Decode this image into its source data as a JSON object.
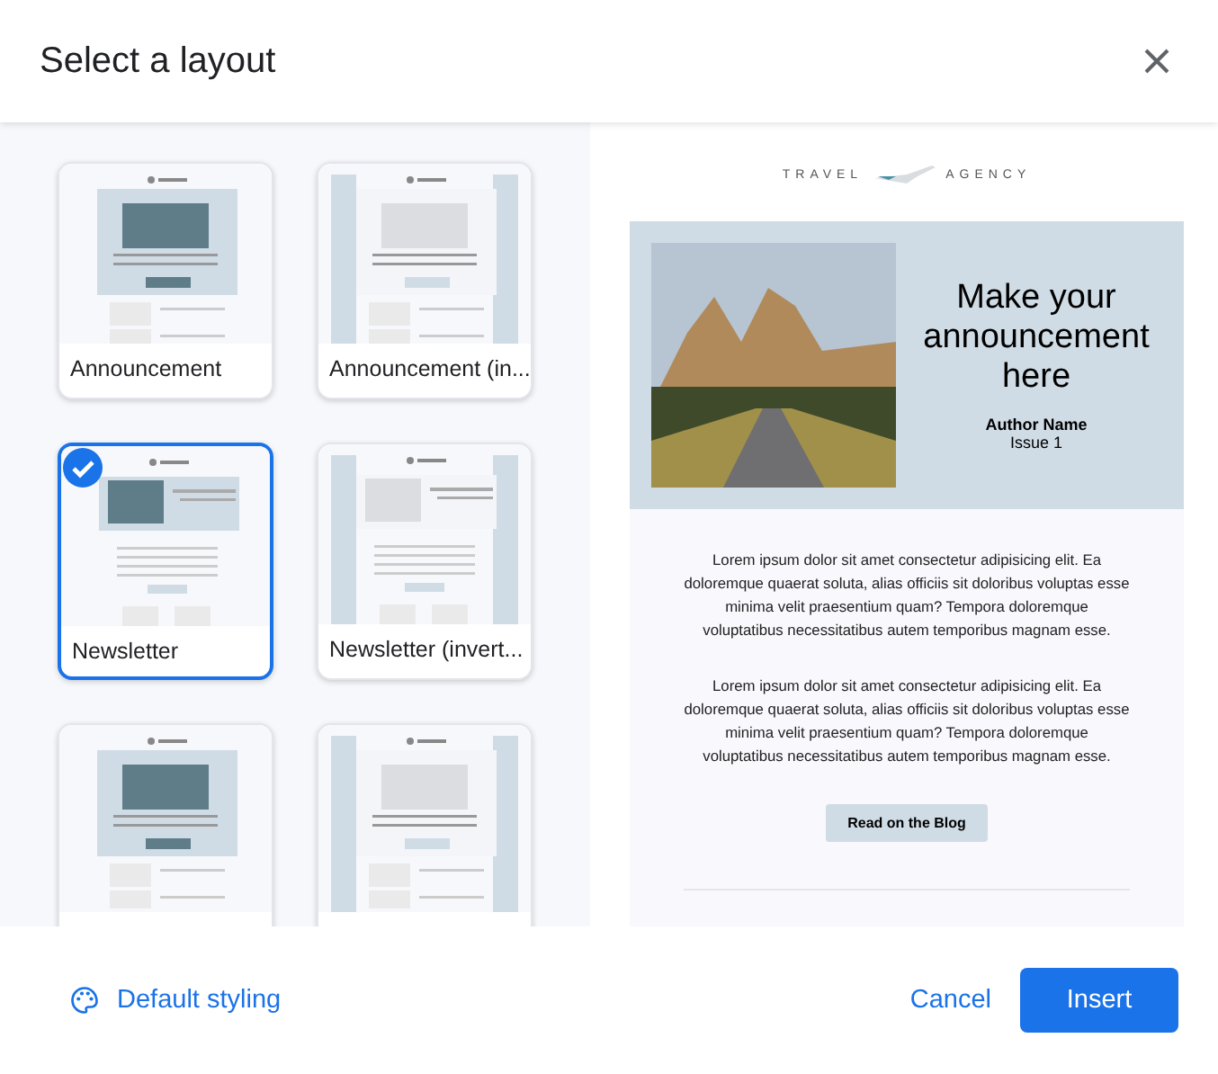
{
  "dialog": {
    "title": "Select a layout"
  },
  "layouts": [
    {
      "label": "Announcement",
      "kind": "announcement",
      "inverted": false,
      "selected": false
    },
    {
      "label": "Announcement (in...",
      "kind": "announcement",
      "inverted": true,
      "selected": false
    },
    {
      "label": "Newsletter",
      "kind": "newsletter",
      "inverted": false,
      "selected": true
    },
    {
      "label": "Newsletter (invert...",
      "kind": "newsletter",
      "inverted": true,
      "selected": false
    },
    {
      "kind": "list",
      "inverted": false,
      "selected": false
    },
    {
      "kind": "list",
      "inverted": true,
      "selected": false
    }
  ],
  "preview": {
    "logo_left": "TRAVEL",
    "logo_right": "AGENCY",
    "headline": "Make your announcement here",
    "author": "Author Name",
    "issue": "Issue 1",
    "paragraphs": [
      "Lorem ipsum dolor sit amet consectetur adipisicing elit. Ea doloremque quaerat soluta, alias officiis sit doloribus voluptas esse minima velit praesentium quam? Tempora doloremque voluptatibus necessitatibus autem temporibus magnam esse.",
      "Lorem ipsum dolor sit amet consectetur adipisicing elit. Ea doloremque quaerat soluta, alias officiis sit doloribus voluptas esse minima velit praesentium quam? Tempora doloremque voluptatibus necessitatibus autem temporibus magnam esse."
    ],
    "button": "Read on the Blog"
  },
  "footer": {
    "styling": "Default styling",
    "cancel": "Cancel",
    "insert": "Insert"
  }
}
